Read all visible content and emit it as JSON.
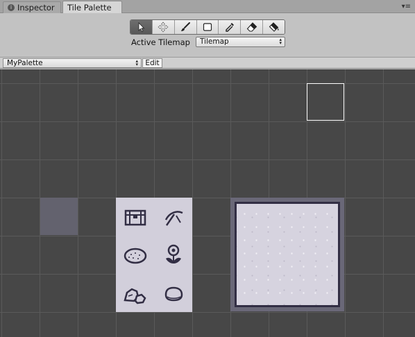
{
  "tabs": [
    {
      "label": "Inspector",
      "icon": "info-icon",
      "active": false
    },
    {
      "label": "Tile Palette",
      "active": true
    }
  ],
  "tab_menu_glyph": "▾≡",
  "toolbar": {
    "tools": [
      {
        "name": "select",
        "icon": "select-arrow-icon",
        "active": true
      },
      {
        "name": "move",
        "icon": "move-icon",
        "active": false
      },
      {
        "name": "paint",
        "icon": "brush-icon",
        "active": false
      },
      {
        "name": "box-fill",
        "icon": "box-fill-icon",
        "active": false
      },
      {
        "name": "picker",
        "icon": "eyedropper-icon",
        "active": false
      },
      {
        "name": "erase",
        "icon": "eraser-icon",
        "active": false
      },
      {
        "name": "flood-fill",
        "icon": "paint-bucket-icon",
        "active": false
      }
    ],
    "active_tilemap_label": "Active Tilemap",
    "active_tilemap_value": "Tilemap"
  },
  "palette_bar": {
    "palette_value": "MyPalette",
    "edit_label": "Edit"
  },
  "palette_tiles": [
    "chest-tile",
    "pickaxe-tile",
    "bread-tile",
    "flower-tile",
    "rocks-tile",
    "stone-tile"
  ],
  "colors": {
    "canvas_bg": "#474747",
    "grid_line": "#5a5a5a",
    "tile_bg": "#d2cfdb",
    "tile_ink": "#322e44",
    "selected_cell": "#63626e"
  }
}
